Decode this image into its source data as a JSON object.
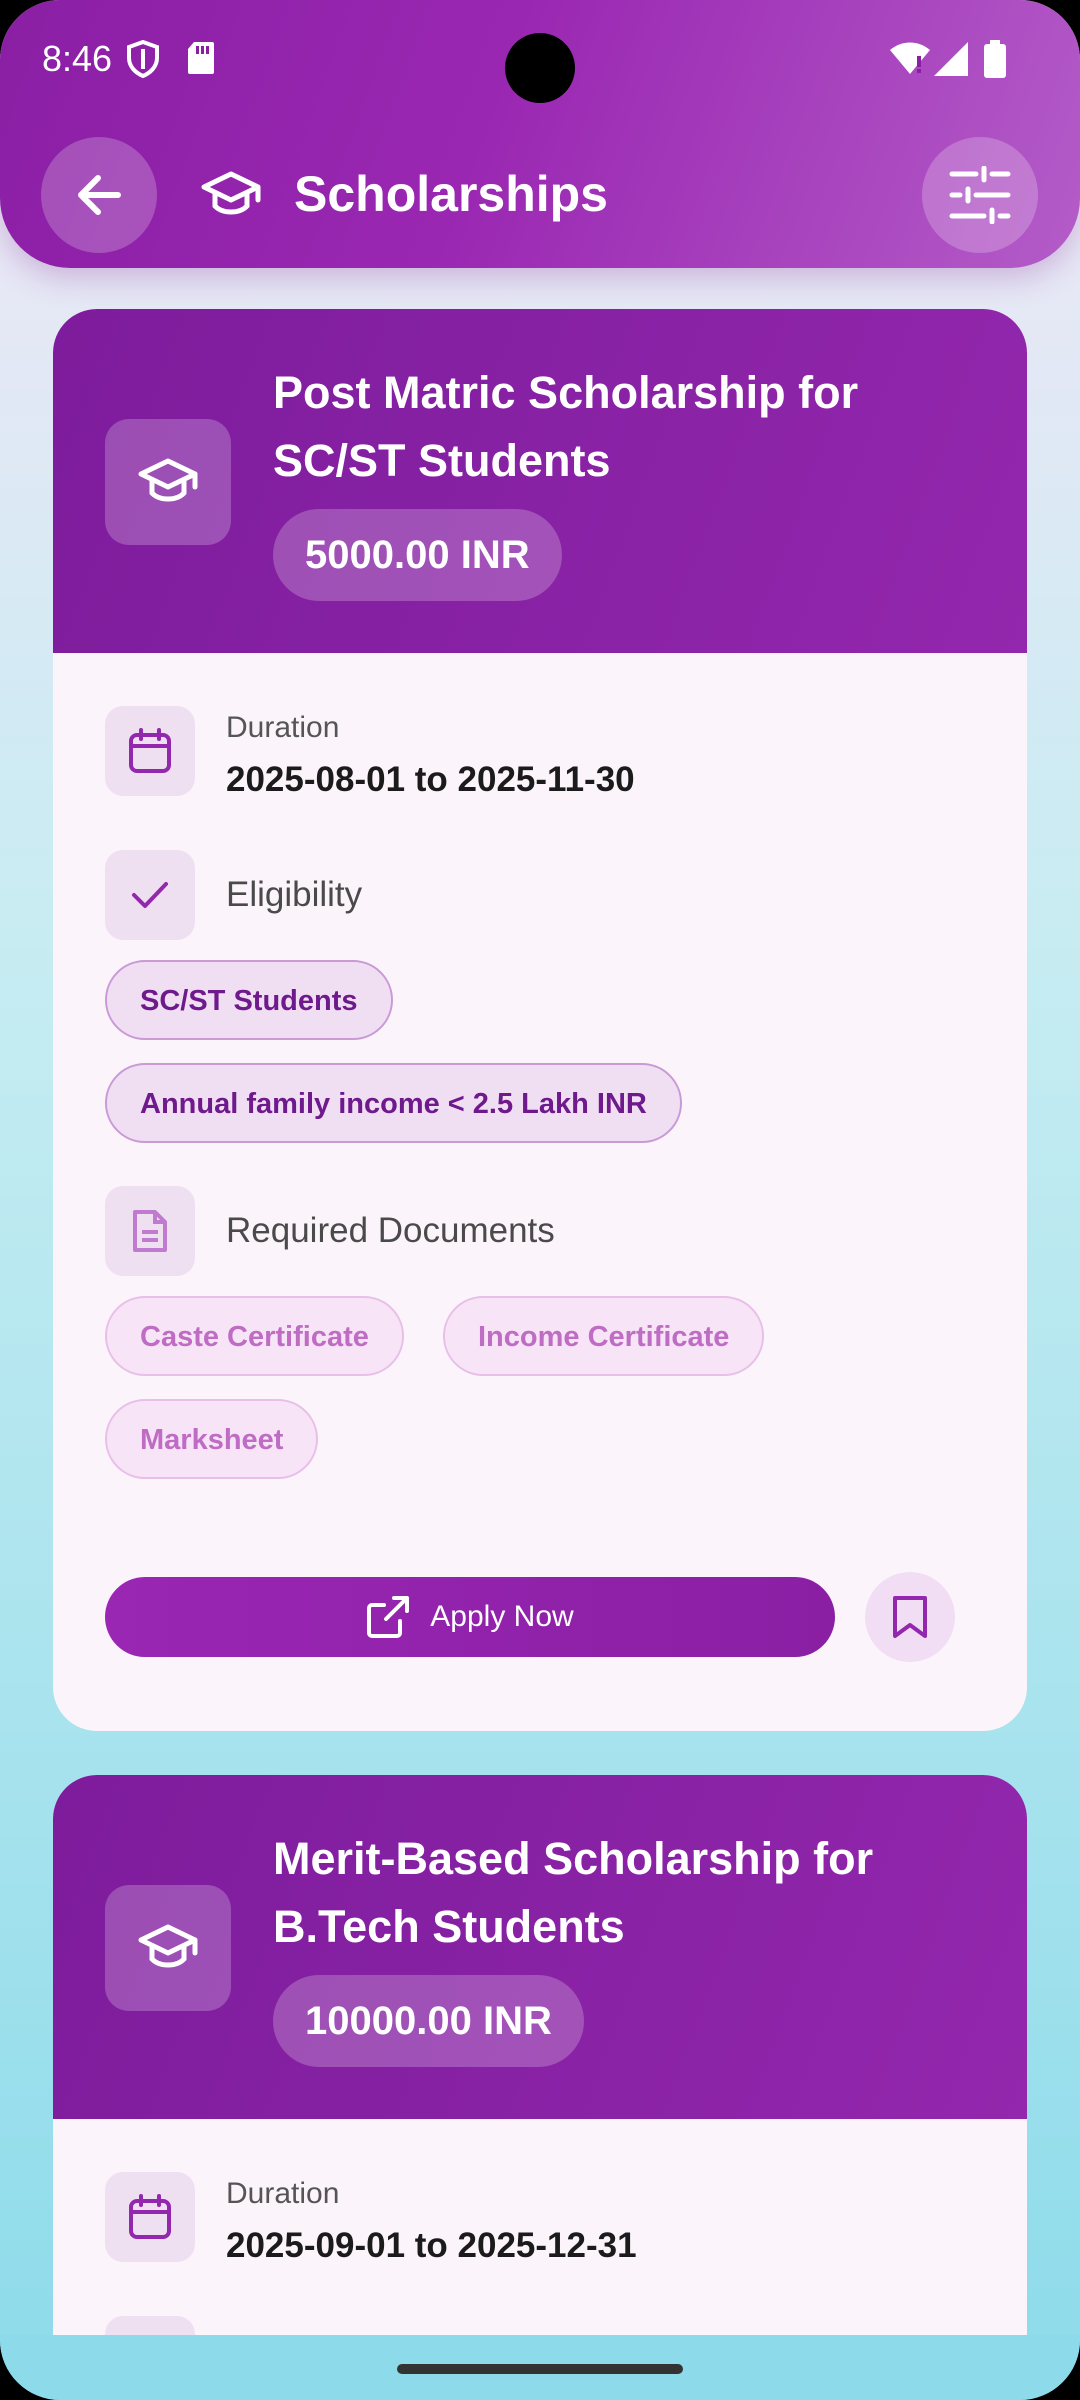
{
  "status_bar": {
    "time": "8:46"
  },
  "header": {
    "title": "Scholarships"
  },
  "scholarships": [
    {
      "title": "Post Matric Scholarship for SC/ST Students",
      "amount": "5000.00 INR",
      "duration_label": "Duration",
      "duration": "2025-08-01 to 2025-11-30",
      "eligibility_label": "Eligibility",
      "eligibility": [
        "SC/ST Students",
        "Annual family income < 2.5 Lakh INR"
      ],
      "documents_label": "Required Documents",
      "documents": [
        "Caste Certificate",
        "Income Certificate",
        "Marksheet"
      ],
      "apply_label": "Apply Now"
    },
    {
      "title": "Merit-Based Scholarship for B.Tech Students",
      "amount": "10000.00 INR",
      "duration_label": "Duration",
      "duration": "2025-09-01 to 2025-12-31"
    }
  ],
  "colors": {
    "primary": "#8a1fa4",
    "accent": "#9327ad",
    "chip_text": "#6f1a8c"
  }
}
